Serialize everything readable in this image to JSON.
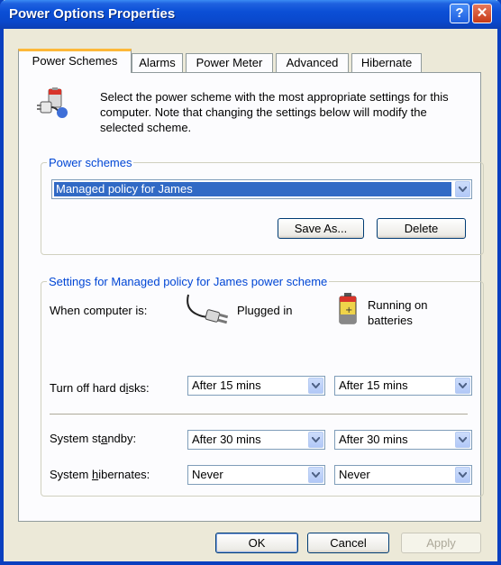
{
  "window": {
    "title": "Power Options Properties"
  },
  "tabs": [
    "Power Schemes",
    "Alarms",
    "Power Meter",
    "Advanced",
    "Hibernate"
  ],
  "intro": "Select the power scheme with the most appropriate settings for this computer. Note that changing the settings below will modify the selected scheme.",
  "schemes": {
    "legend": "Power schemes",
    "selected": "Managed policy for James",
    "save_as": "Save As...",
    "delete": "Delete"
  },
  "settings": {
    "legend": "Settings for Managed policy for James power scheme",
    "when_label": "When computer is:",
    "plugged_label": "Plugged in",
    "battery_label": "Running on batteries",
    "rows": [
      {
        "label": "Turn off hard disks:",
        "plugged": "After 15 mins",
        "battery": "After 15 mins"
      },
      {
        "label": "System standby:",
        "plugged": "After 30 mins",
        "battery": "After 30 mins"
      },
      {
        "label": "System hibernates:",
        "plugged": "Never",
        "battery": "Never"
      }
    ]
  },
  "buttons": {
    "ok": "OK",
    "cancel": "Cancel",
    "apply": "Apply"
  },
  "colors": {
    "titlebar": "#0a48cc",
    "legend": "#0046d5",
    "selection": "#316ac5",
    "tab_accent": "#fdb839"
  }
}
